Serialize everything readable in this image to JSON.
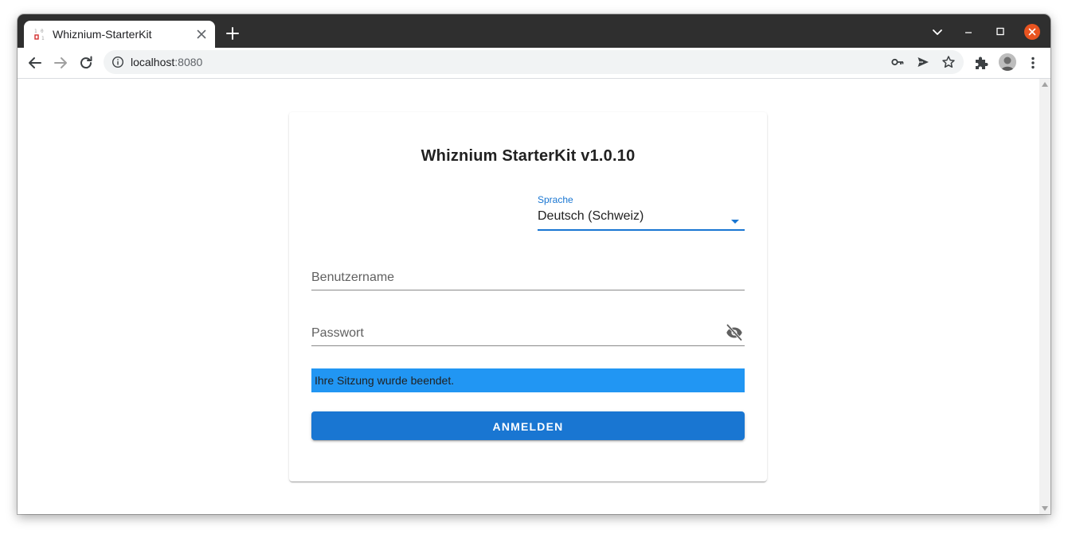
{
  "browser": {
    "tab": {
      "title": "Whiznium-StarterKit"
    },
    "address": {
      "host": "localhost",
      "port": ":8080"
    },
    "icons": {
      "back": "arrow-left-icon",
      "forward": "arrow-right-icon",
      "reload": "reload-icon",
      "site_info": "info-icon",
      "passwords": "key-icon",
      "send": "send-icon",
      "bookmark": "star-icon",
      "extensions": "puzzle-icon",
      "menu": "kebab-menu-icon"
    },
    "colors": {
      "close_button": "#e95420",
      "frame": "#2f2f2f"
    }
  },
  "login": {
    "title": "Whiznium StarterKit v1.0.10",
    "language": {
      "label": "Sprache",
      "selected": "Deutsch (Schweiz)"
    },
    "username": {
      "label": "Benutzername"
    },
    "password": {
      "label": "Passwort"
    },
    "alert": "Ihre Sitzung wurde beendet.",
    "submit_label": "ANMELDEN",
    "colors": {
      "primary": "#1976d2",
      "alert_bg": "#2196f3"
    }
  }
}
